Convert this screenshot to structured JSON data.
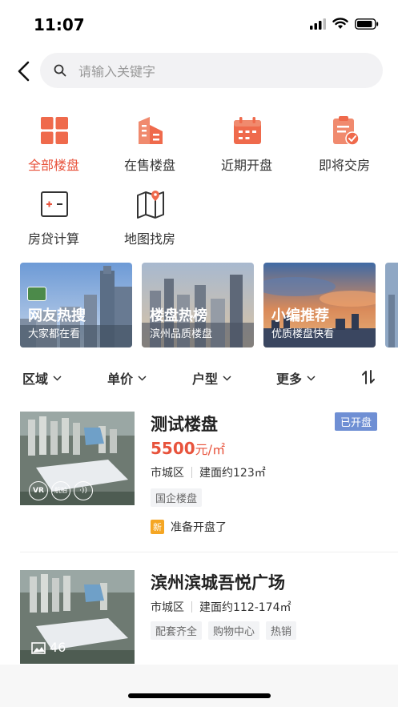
{
  "status_bar": {
    "time": "11:07"
  },
  "search": {
    "placeholder": "请输入关键字"
  },
  "categories": [
    {
      "label": "全部楼盘",
      "icon": "grid-icon",
      "active": true
    },
    {
      "label": "在售楼盘",
      "icon": "buildings-icon"
    },
    {
      "label": "近期开盘",
      "icon": "calendar-icon"
    },
    {
      "label": "即将交房",
      "icon": "checklist-icon"
    },
    {
      "label": "房贷计算",
      "icon": "calculator-icon"
    },
    {
      "label": "地图找房",
      "icon": "map-icon"
    }
  ],
  "banners": [
    {
      "title": "网友热搜",
      "subtitle": "大家都在看"
    },
    {
      "title": "楼盘热榜",
      "subtitle": "滨州品质楼盘"
    },
    {
      "title": "小编推荐",
      "subtitle": "优质楼盘快看"
    }
  ],
  "filters": [
    {
      "label": "区域"
    },
    {
      "label": "单价"
    },
    {
      "label": "户型"
    },
    {
      "label": "更多"
    }
  ],
  "listings": [
    {
      "name": "测试楼盘",
      "status": "已开盘",
      "price": "5500",
      "price_unit": "元/㎡",
      "district": "市城区",
      "area": "建面约123㎡",
      "tags": [
        "国企楼盘"
      ],
      "news_badge": "新",
      "news_text": "准备开盘了",
      "image_badges": [
        "VR",
        "航拍",
        "·))"
      ]
    },
    {
      "name": "滨州滨城吾悦广场",
      "district": "市城区",
      "area": "建面约112-174㎡",
      "tags": [
        "配套齐全",
        "购物中心",
        "热销"
      ],
      "photo_count": "46"
    }
  ],
  "colors": {
    "accent": "#e8533c",
    "badge_blue": "#6f8fd4",
    "badge_orange": "#f5a623"
  }
}
